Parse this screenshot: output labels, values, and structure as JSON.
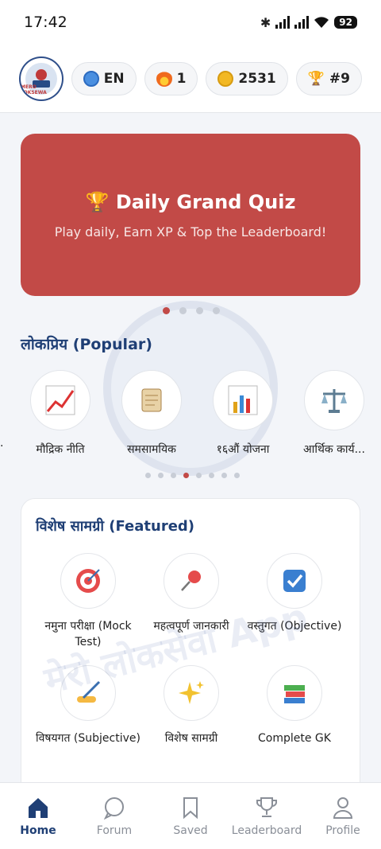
{
  "status_bar": {
    "time": "17:42",
    "battery": "92"
  },
  "top_bar": {
    "logo_text": "MERO LOKSEWA",
    "language": "EN",
    "streak": "1",
    "coins": "2531",
    "rank": "#9"
  },
  "banner": {
    "title": "🏆 Daily Grand Quiz",
    "subtitle": "Play daily, Earn XP & Top the Leaderboard!"
  },
  "watermark": {
    "text": "मेरो लोकसेवा App"
  },
  "popular": {
    "title": "लोकप्रिय (Popular)",
    "items": [
      {
        "label": "मौद्रिक नीति",
        "icon": "chart-up-icon"
      },
      {
        "label": "समसामयिक",
        "icon": "scroll-icon"
      },
      {
        "label": "१६औं योजना",
        "icon": "bar-chart-icon"
      },
      {
        "label": "आर्थिक कार्य...",
        "icon": "scales-icon"
      }
    ]
  },
  "featured": {
    "title": "विशेष सामग्री (Featured)",
    "items": [
      {
        "label": "नमुना परीक्षा (Mock Test)",
        "icon": "target-icon"
      },
      {
        "label": "महत्वपूर्ण जानकारी",
        "icon": "pin-icon"
      },
      {
        "label": "वस्तुगत (Objective)",
        "icon": "checkbox-icon"
      },
      {
        "label": "विषयगत (Subjective)",
        "icon": "writing-hand-icon"
      },
      {
        "label": "विशेष सामग्री",
        "icon": "sparkles-icon"
      },
      {
        "label": "Complete GK",
        "icon": "books-icon"
      }
    ]
  },
  "bottom_nav": {
    "active": "Home",
    "items": [
      {
        "label": "Home",
        "icon": "home-icon"
      },
      {
        "label": "Forum",
        "icon": "chat-bubble-icon"
      },
      {
        "label": "Saved",
        "icon": "bookmark-icon"
      },
      {
        "label": "Leaderboard",
        "icon": "trophy-icon"
      },
      {
        "label": "Profile",
        "icon": "person-icon"
      }
    ]
  },
  "colors": {
    "primary": "#1f3f75",
    "banner": "#c24a47",
    "background": "#f3f5f9"
  }
}
